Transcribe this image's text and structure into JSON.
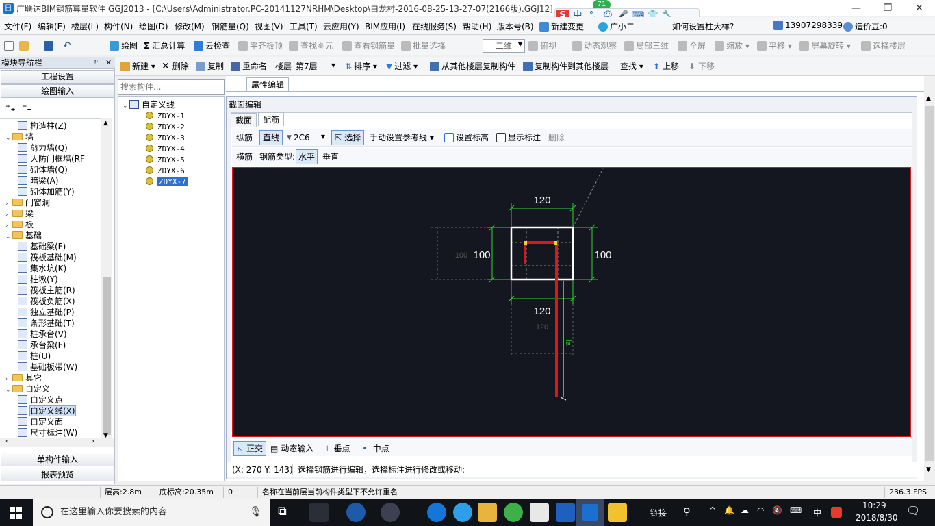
{
  "window": {
    "title": "广联达BIM钢筋算量软件 GGJ2013 - [C:\\Users\\Administrator.PC-20141127NRHM\\Desktop\\白龙村-2016-08-25-13-27-07(2166版).GGJ12]",
    "app_icon": "日",
    "min": "—",
    "max": "❐",
    "close": "✕"
  },
  "ime": {
    "badge": "71",
    "items": [
      "S",
      "中",
      "°,",
      "☺",
      "🎤",
      "⌨",
      "👕",
      "🔧"
    ]
  },
  "menu": [
    "文件(F)",
    "编辑(E)",
    "楼层(L)",
    "构件(N)",
    "绘图(D)",
    "修改(M)",
    "钢筋量(Q)",
    "视图(V)",
    "工具(T)",
    "云应用(Y)",
    "BIM应用(I)",
    "在线服务(S)",
    "帮助(H)",
    "版本号(B)",
    "新建变更",
    "广小二"
  ],
  "menu_right": {
    "question": "如何设置柱大样?",
    "phone": "13907298339",
    "price": "造价豆:0"
  },
  "toolbar1": {
    "draw": "绘图",
    "sum": "汇总计算",
    "cloud_check": "云检查",
    "align_top": "平齐板顶",
    "find_elem": "查找图元",
    "view_rebar": "查看钢筋量",
    "batch_select": "批量选择",
    "view_mode": "二维",
    "topview": "俯视",
    "dynamic": "动态观察",
    "local3d": "局部三维",
    "fullscreen": "全屏",
    "zoom": "缩放",
    "pan": "平移",
    "rotate": "屏幕旋转",
    "select_floor": "选择楼层"
  },
  "toolbar2": {
    "new": "新建",
    "delete": "删除",
    "copy": "复制",
    "rename": "重命名",
    "floor_label": "楼层",
    "floor_value": "第7层",
    "sort": "排序",
    "filter": "过滤",
    "copy_from": "从其他楼层复制构件",
    "copy_to": "复制构件到其他楼层",
    "find": "查找",
    "up": "上移",
    "down": "下移"
  },
  "nav": {
    "title": "模块导航栏",
    "pin": "ᵖ",
    "close": "✕",
    "sections": [
      "工程设置",
      "绘图输入"
    ],
    "tree": [
      {
        "label": "构造柱(Z)",
        "indent": 2,
        "type": "item"
      },
      {
        "label": "墙",
        "indent": 1,
        "type": "folder",
        "exp": "⌄"
      },
      {
        "label": "剪力墙(Q)",
        "indent": 2,
        "type": "item"
      },
      {
        "label": "人防门框墙(RF",
        "indent": 2,
        "type": "item"
      },
      {
        "label": "砌体墙(Q)",
        "indent": 2,
        "type": "item"
      },
      {
        "label": "暗梁(A)",
        "indent": 2,
        "type": "item"
      },
      {
        "label": "砌体加筋(Y)",
        "indent": 2,
        "type": "item"
      },
      {
        "label": "门窗洞",
        "indent": 1,
        "type": "folder",
        "exp": "›"
      },
      {
        "label": "梁",
        "indent": 1,
        "type": "folder",
        "exp": "›"
      },
      {
        "label": "板",
        "indent": 1,
        "type": "folder",
        "exp": "›"
      },
      {
        "label": "基础",
        "indent": 1,
        "type": "folder",
        "exp": "⌄"
      },
      {
        "label": "基础梁(F)",
        "indent": 2,
        "type": "item"
      },
      {
        "label": "筏板基础(M)",
        "indent": 2,
        "type": "item"
      },
      {
        "label": "集水坑(K)",
        "indent": 2,
        "type": "item"
      },
      {
        "label": "柱墩(Y)",
        "indent": 2,
        "type": "item"
      },
      {
        "label": "筏板主筋(R)",
        "indent": 2,
        "type": "item"
      },
      {
        "label": "筏板负筋(X)",
        "indent": 2,
        "type": "item"
      },
      {
        "label": "独立基础(P)",
        "indent": 2,
        "type": "item"
      },
      {
        "label": "条形基础(T)",
        "indent": 2,
        "type": "item"
      },
      {
        "label": "桩承台(V)",
        "indent": 2,
        "type": "item"
      },
      {
        "label": "承台梁(F)",
        "indent": 2,
        "type": "item"
      },
      {
        "label": "桩(U)",
        "indent": 2,
        "type": "item"
      },
      {
        "label": "基础板带(W)",
        "indent": 2,
        "type": "item"
      },
      {
        "label": "其它",
        "indent": 1,
        "type": "folder",
        "exp": "›"
      },
      {
        "label": "自定义",
        "indent": 1,
        "type": "folder",
        "exp": "⌄"
      },
      {
        "label": "自定义点",
        "indent": 2,
        "type": "item"
      },
      {
        "label": "自定义线(X)",
        "indent": 2,
        "type": "item",
        "selected": true
      },
      {
        "label": "自定义面",
        "indent": 2,
        "type": "item"
      },
      {
        "label": "尺寸标注(W)",
        "indent": 2,
        "type": "item"
      }
    ],
    "bottom": [
      "单构件输入",
      "报表预览"
    ]
  },
  "components": {
    "search_placeholder": "搜索构件...",
    "root": "自定义线",
    "items": [
      "ZDYX-1",
      "ZDYX-2",
      "ZDYX-3",
      "ZDYX-4",
      "ZDYX-5",
      "ZDYX-6",
      "ZDYX-7"
    ],
    "selected": "ZDYX-7"
  },
  "property": {
    "tab": "属性编辑"
  },
  "section_editor": {
    "title": "截面编辑",
    "tabs": [
      "截面",
      "配筋"
    ],
    "row1": {
      "longitudinal": "纵筋",
      "straight": "直线",
      "spec": "2C6",
      "select": "选择",
      "manual_ref": "手动设置参考线",
      "set_elev": "设置标高",
      "show_dim": "显示标注",
      "delete": "删除"
    },
    "row2": {
      "transverse": "横筋",
      "rebar_type_label": "钢筋类型:",
      "horizontal": "水平",
      "vertical": "垂直"
    },
    "drawing": {
      "top_dim": "120",
      "bottom_dim": "120",
      "bottom_dim_gray": "120",
      "left_dim": "100",
      "left_dim_gray": "100",
      "right_dim": "100",
      "la_label": "la"
    },
    "bottom_tools": [
      "正交",
      "动态输入",
      "垂点",
      "中点"
    ],
    "coords": "(X: 270 Y: 143)",
    "hint": "选择钢筋进行编辑，选择标注进行修改或移动;"
  },
  "status": {
    "floor_height": "层高:2.8m",
    "base_elev": "底标高:20.35m",
    "num": "0",
    "message": "名称在当前层当前构件类型下不允许重名",
    "fps": "236.3 FPS"
  },
  "taskbar": {
    "search": "在这里输入你要搜索的内容",
    "link": "链接",
    "ime": "中",
    "time": "10:29",
    "date": "2018/8/30"
  },
  "colors": {
    "accent": "#1a6fd1",
    "canvas_bg": "#14171f",
    "canvas_border": "#e0151c",
    "rebar": "#e0151c",
    "dim_green": "#33d13a"
  }
}
